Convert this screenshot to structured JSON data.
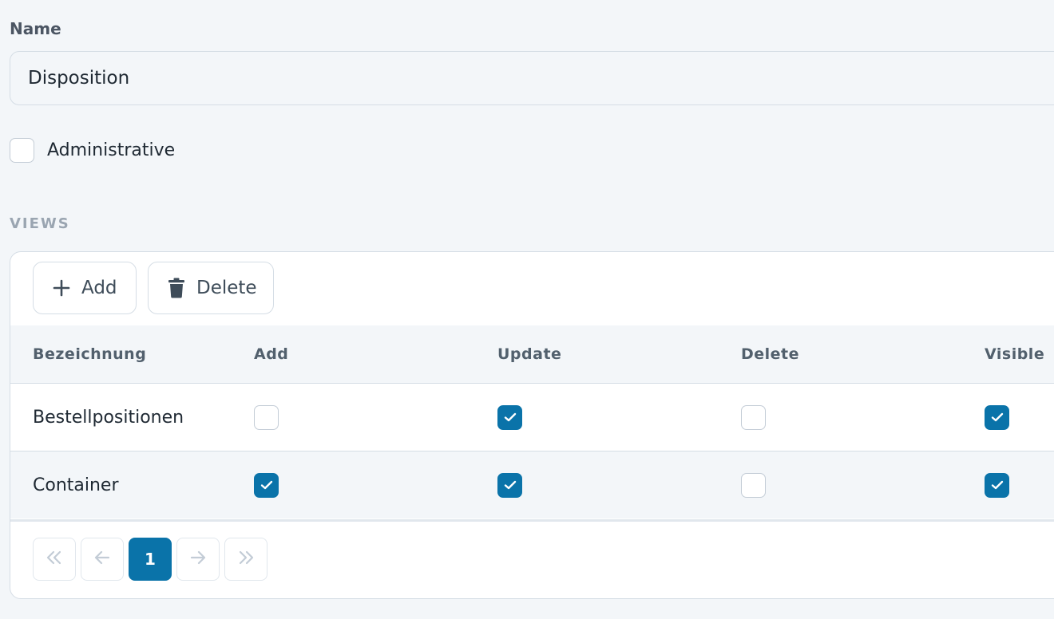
{
  "form": {
    "name_label": "Name",
    "name_value": "Disposition",
    "administrative_label": "Administrative",
    "administrative_checked": false
  },
  "views": {
    "heading": "VIEWS",
    "toolbar": {
      "add_label": "Add",
      "add_icon": "plus-icon",
      "delete_label": "Delete",
      "delete_icon": "trash-icon"
    },
    "columns": [
      "Bezeichnung",
      "Add",
      "Update",
      "Delete",
      "Visible"
    ],
    "rows": [
      {
        "name": "Bestellpositionen",
        "add": false,
        "update": true,
        "delete": false,
        "visible": true
      },
      {
        "name": "Container",
        "add": true,
        "update": true,
        "delete": false,
        "visible": true
      }
    ],
    "pagination": {
      "first_icon": "double-chevron-left-icon",
      "prev_icon": "arrow-left-icon",
      "current_page": "1",
      "next_icon": "arrow-right-icon",
      "last_icon": "double-chevron-right-icon"
    }
  },
  "colors": {
    "accent": "#0a73a9",
    "background": "#f3f6f9",
    "border": "#d5dde5"
  }
}
